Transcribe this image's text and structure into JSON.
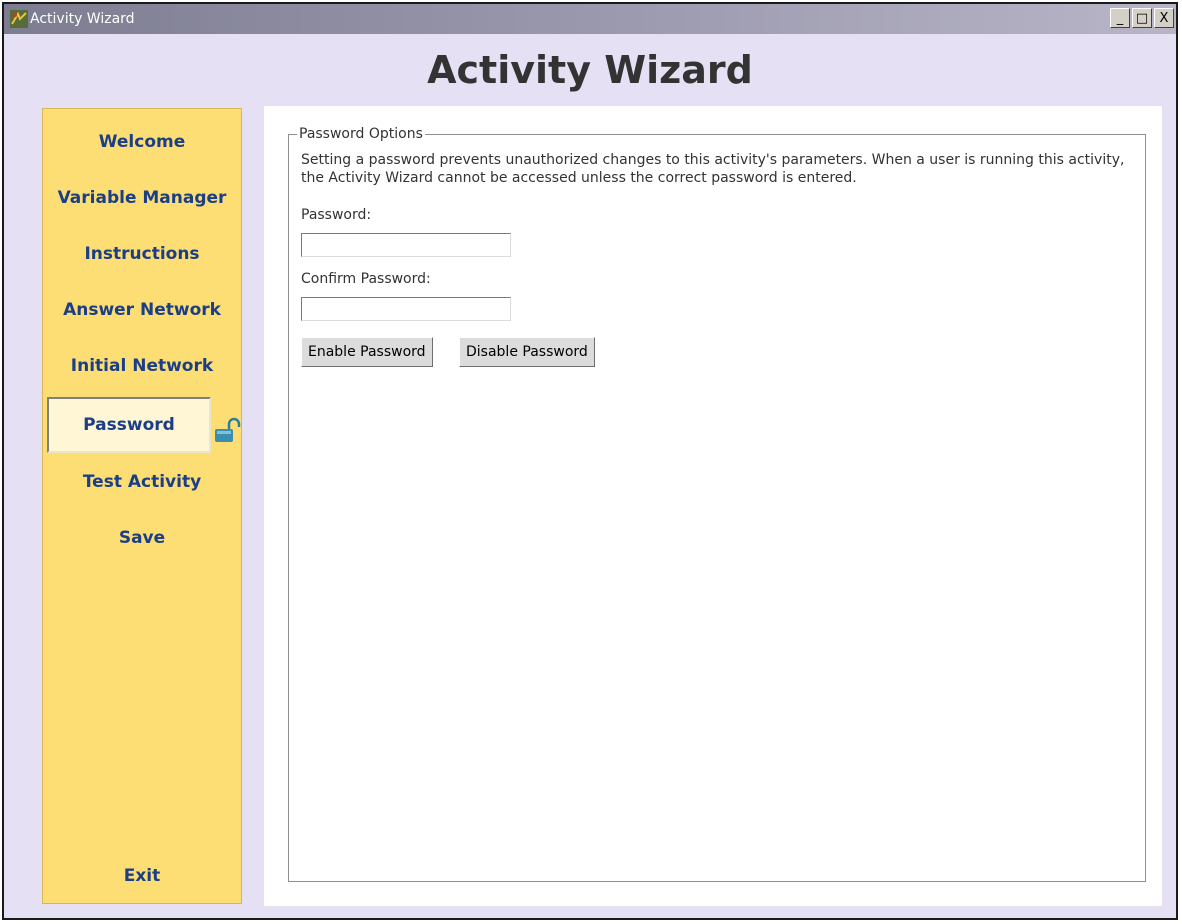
{
  "window": {
    "title": "Activity Wizard",
    "controls": {
      "minimize": "_",
      "maximize": "□",
      "close": "X"
    }
  },
  "header": {
    "title": "Activity Wizard"
  },
  "sidebar": {
    "items": [
      {
        "label": "Welcome"
      },
      {
        "label": "Variable Manager"
      },
      {
        "label": "Instructions"
      },
      {
        "label": "Answer Network"
      },
      {
        "label": "Initial Network"
      },
      {
        "label": "Password",
        "active": true
      },
      {
        "label": "Test Activity"
      },
      {
        "label": "Save"
      }
    ],
    "exit_label": "Exit"
  },
  "password_options": {
    "legend": "Password Options",
    "description": "Setting a password prevents unauthorized changes to this activity's parameters. When a user is running this activity, the Activity Wizard cannot be accessed unless the correct password is entered.",
    "password_label": "Password:",
    "password_value": "",
    "confirm_label": "Confirm Password:",
    "confirm_value": "",
    "enable_button": "Enable Password",
    "disable_button": "Disable Password"
  },
  "colors": {
    "window_bg": "#e6e0f5",
    "sidebar_bg": "#fdde75",
    "nav_text": "#1b3f86",
    "title_text": "#333333"
  },
  "icons": {
    "app": "app-icon",
    "lock": "lock-open-icon"
  }
}
